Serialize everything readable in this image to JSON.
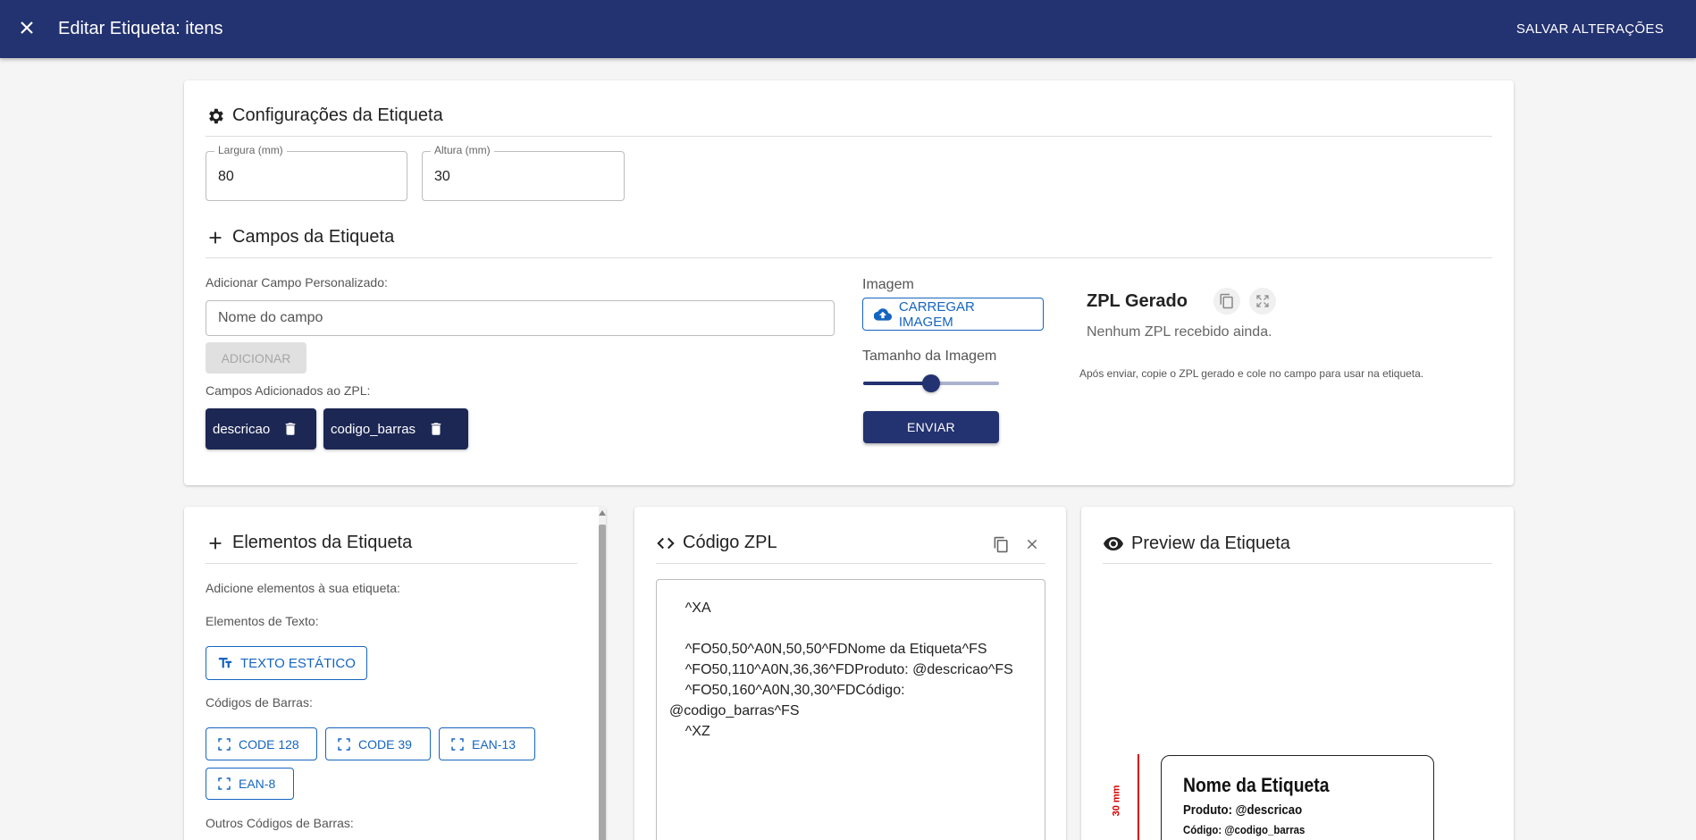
{
  "appbar": {
    "title": "Editar Etiqueta: itens",
    "save_label": "SALVAR ALTERAÇÕES"
  },
  "config": {
    "heading": "Configurações da Etiqueta",
    "width_label": "Largura (mm)",
    "width_value": "80",
    "height_label": "Altura (mm)",
    "height_value": "30"
  },
  "fields": {
    "heading": "Campos da Etiqueta",
    "custom_label": "Adicionar Campo Personalizado:",
    "custom_placeholder": "Nome do campo",
    "add_button": "ADICIONAR",
    "added_label": "Campos Adicionados ao ZPL:",
    "chips": [
      "descricao",
      "codigo_barras"
    ]
  },
  "image": {
    "label": "Imagem",
    "upload_button": "CARREGAR IMAGEM",
    "size_label": "Tamanho da Imagem",
    "size_value_percent": 50,
    "send_button": "ENVIAR"
  },
  "zpl_generated": {
    "title": "ZPL Gerado",
    "empty_text": "Nenhum ZPL recebido ainda.",
    "hint": "Após enviar, copie o ZPL gerado e cole no campo para usar na etiqueta."
  },
  "elements": {
    "heading": "Elementos da Etiqueta",
    "intro": "Adicione elementos à sua etiqueta:",
    "text_label": "Elementos de Texto:",
    "static_text_button": "TEXTO ESTÁTICO",
    "barcodes_label": "Códigos de Barras:",
    "barcode_buttons": [
      "CODE 128",
      "CODE 39",
      "EAN-13",
      "EAN-8"
    ],
    "other_barcodes_label": "Outros Códigos de Barras:"
  },
  "zpl_code": {
    "heading": "Código ZPL",
    "code": "    ^XA\n\n    ^FO50,50^A0N,50,50^FDNome da Etiqueta^FS\n    ^FO50,110^A0N,36,36^FDProduto: @descricao^FS\n    ^FO50,160^A0N,30,30^FDCódigo:\n@codigo_barras^FS\n    ^XZ"
  },
  "preview": {
    "heading": "Preview da Etiqueta",
    "dimension_label": "30 mm",
    "label_title": "Nome da Etiqueta",
    "label_line1": "Produto:  @descricao",
    "label_line2": "Código:  @codigo_barras"
  },
  "colors": {
    "primary": "#233270",
    "chip": "#1c2754",
    "accent_blue": "#1565c0",
    "dimension_red": "#d50000"
  }
}
